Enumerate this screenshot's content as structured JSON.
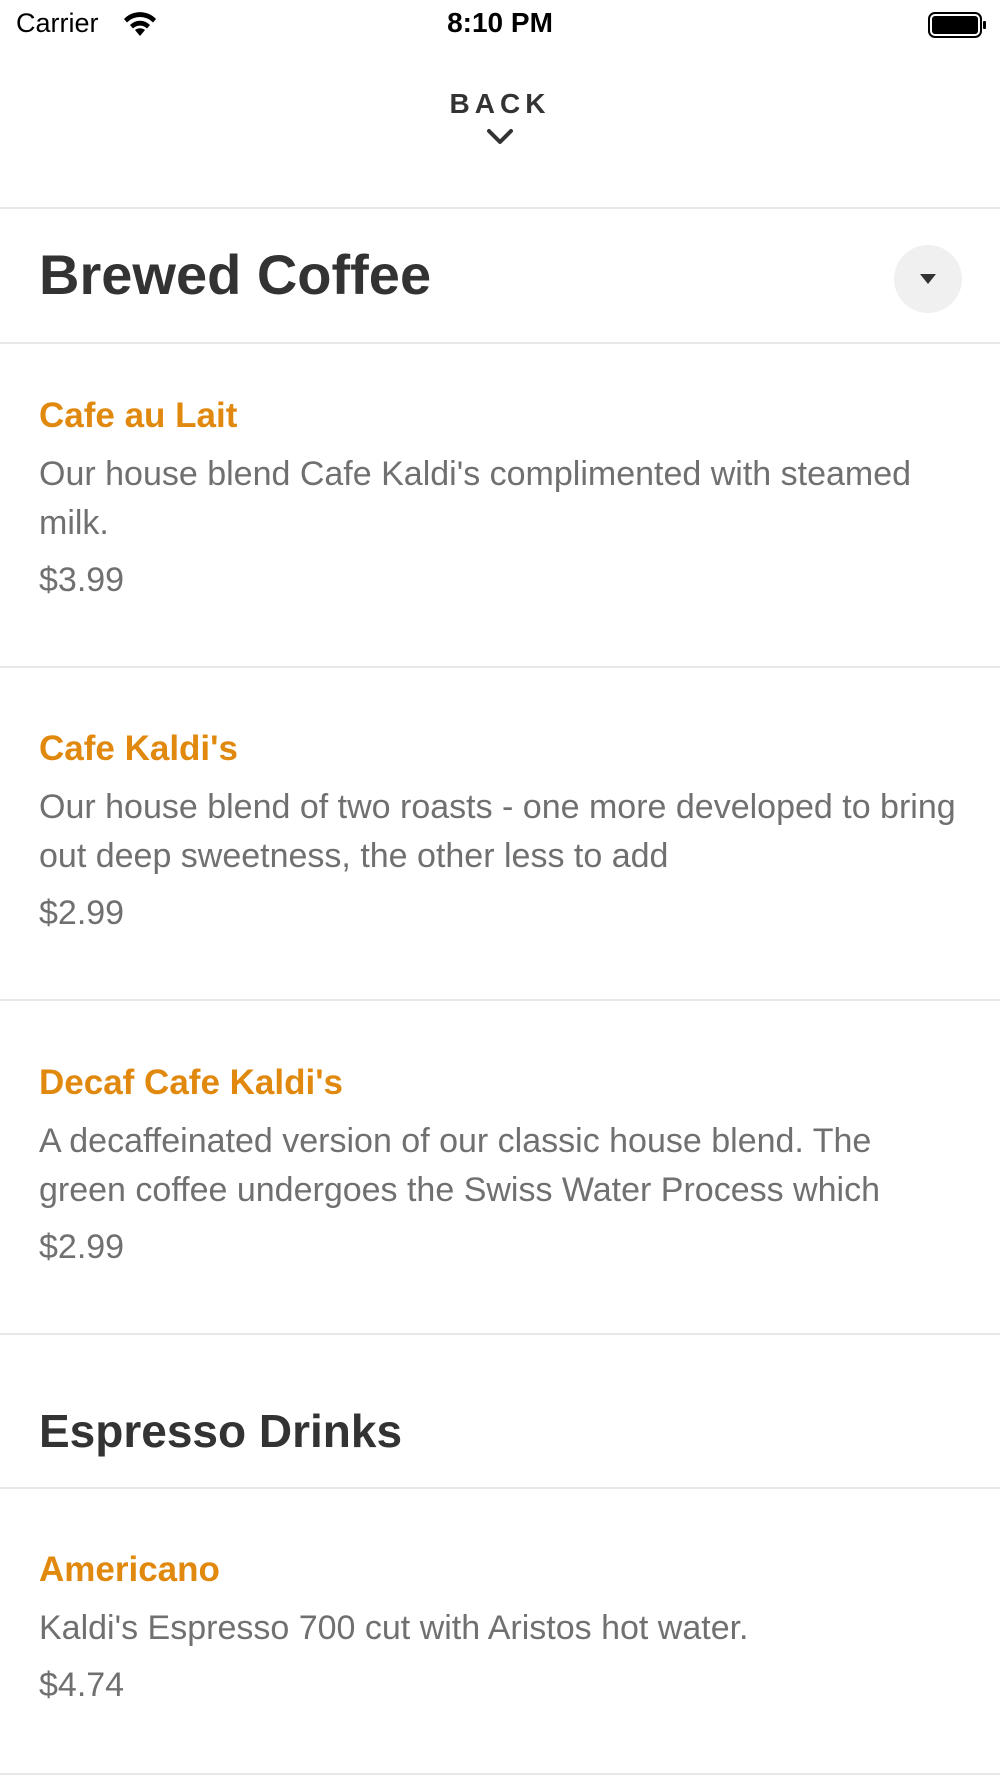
{
  "status_bar": {
    "carrier": "Carrier",
    "time": "8:10 PM"
  },
  "nav": {
    "back_label": "BACK"
  },
  "sections": [
    {
      "title": "Brewed Coffee",
      "items": [
        {
          "name": "Cafe au Lait",
          "description": "Our house blend Cafe Kaldi's complimented with steamed milk.",
          "price": "$3.99"
        },
        {
          "name": "Cafe Kaldi's",
          "description": "Our house blend of two roasts - one more developed to bring out deep sweetness, the other less to add",
          "price": "$2.99"
        },
        {
          "name": "Decaf Cafe Kaldi's",
          "description": "A decaffeinated version of our classic house blend. The green coffee undergoes the Swiss Water Process which",
          "price": "$2.99"
        }
      ]
    },
    {
      "title": "Espresso Drinks",
      "items": [
        {
          "name": "Americano",
          "description": "Kaldi's Espresso 700 cut with Aristos hot water.",
          "price": "$4.74"
        }
      ]
    }
  ],
  "colors": {
    "accent": "#e0890e",
    "text_primary": "#333333",
    "text_secondary": "#707070",
    "divider": "#e8e8e8"
  }
}
